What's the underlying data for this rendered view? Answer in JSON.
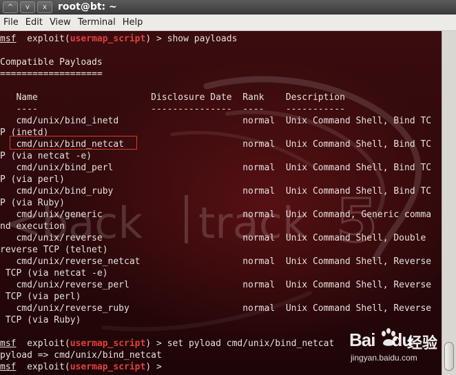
{
  "window": {
    "title": "root@bt: ~",
    "controls": [
      "^",
      "v",
      "x"
    ]
  },
  "menu": [
    "File",
    "Edit",
    "View",
    "Terminal",
    "Help"
  ],
  "prompt": {
    "msf": "msf",
    "pre": "  exploit(",
    "module": "usermap_script",
    "post": ") > "
  },
  "terminal_lines": [
    {
      "type": "prompt",
      "cmd": "show payloads"
    },
    {
      "type": "text",
      "text": ""
    },
    {
      "type": "text",
      "text": "Compatible Payloads"
    },
    {
      "type": "text",
      "text": "==================="
    },
    {
      "type": "text",
      "text": ""
    },
    {
      "type": "text",
      "text": "   Name                     Disclosure Date  Rank    Description"
    },
    {
      "type": "text",
      "text": "   ----                     ---------------  ----    -----------"
    },
    {
      "type": "text",
      "text": "   cmd/unix/bind_inetd                       normal  Unix Command Shell, Bind TC"
    },
    {
      "type": "text",
      "text": "P (inetd)"
    },
    {
      "type": "text",
      "text": "   cmd/unix/bind_netcat                      normal  Unix Command Shell, Bind TC"
    },
    {
      "type": "text",
      "text": "P (via netcat -e)"
    },
    {
      "type": "text",
      "text": "   cmd/unix/bind_perl                        normal  Unix Command Shell, Bind TC"
    },
    {
      "type": "text",
      "text": "P (via perl)"
    },
    {
      "type": "text",
      "text": "   cmd/unix/bind_ruby                        normal  Unix Command Shell, Bind TC"
    },
    {
      "type": "text",
      "text": "P (via Ruby)"
    },
    {
      "type": "text",
      "text": "   cmd/unix/generic                          normal  Unix Command, Generic comma"
    },
    {
      "type": "text",
      "text": "nd execution"
    },
    {
      "type": "text",
      "text": "   cmd/unix/reverse                          normal  Unix Command Shell, Double"
    },
    {
      "type": "text",
      "text": "reverse TCP (telnet)"
    },
    {
      "type": "text",
      "text": "   cmd/unix/reverse_netcat                   normal  Unix Command Shell, Reverse"
    },
    {
      "type": "text",
      "text": " TCP (via netcat -e)"
    },
    {
      "type": "text",
      "text": "   cmd/unix/reverse_perl                     normal  Unix Command Shell, Reverse"
    },
    {
      "type": "text",
      "text": " TCP (via perl)"
    },
    {
      "type": "text",
      "text": "   cmd/unix/reverse_ruby                     normal  Unix Command Shell, Reverse"
    },
    {
      "type": "text",
      "text": " TCP (via Ruby)"
    },
    {
      "type": "text",
      "text": ""
    },
    {
      "type": "prompt",
      "cmd": "set pyload cmd/unix/bind_netcat"
    },
    {
      "type": "text",
      "text": "pyload => cmd/unix/bind_netcat"
    },
    {
      "type": "prompt",
      "cmd": ""
    }
  ],
  "background_logo": {
    "left": "<back",
    "right": "track",
    "number": "5"
  },
  "baidu": {
    "logo": "Bai",
    "logo2": "du",
    "jingyan": "经验",
    "url": "jingyan.baidu.com"
  },
  "colors": {
    "terminal_text": "#e6e0de",
    "module_red": "#e0403c",
    "highlight_box": "#d93a33",
    "terminal_bg": "#2b0a0c"
  }
}
